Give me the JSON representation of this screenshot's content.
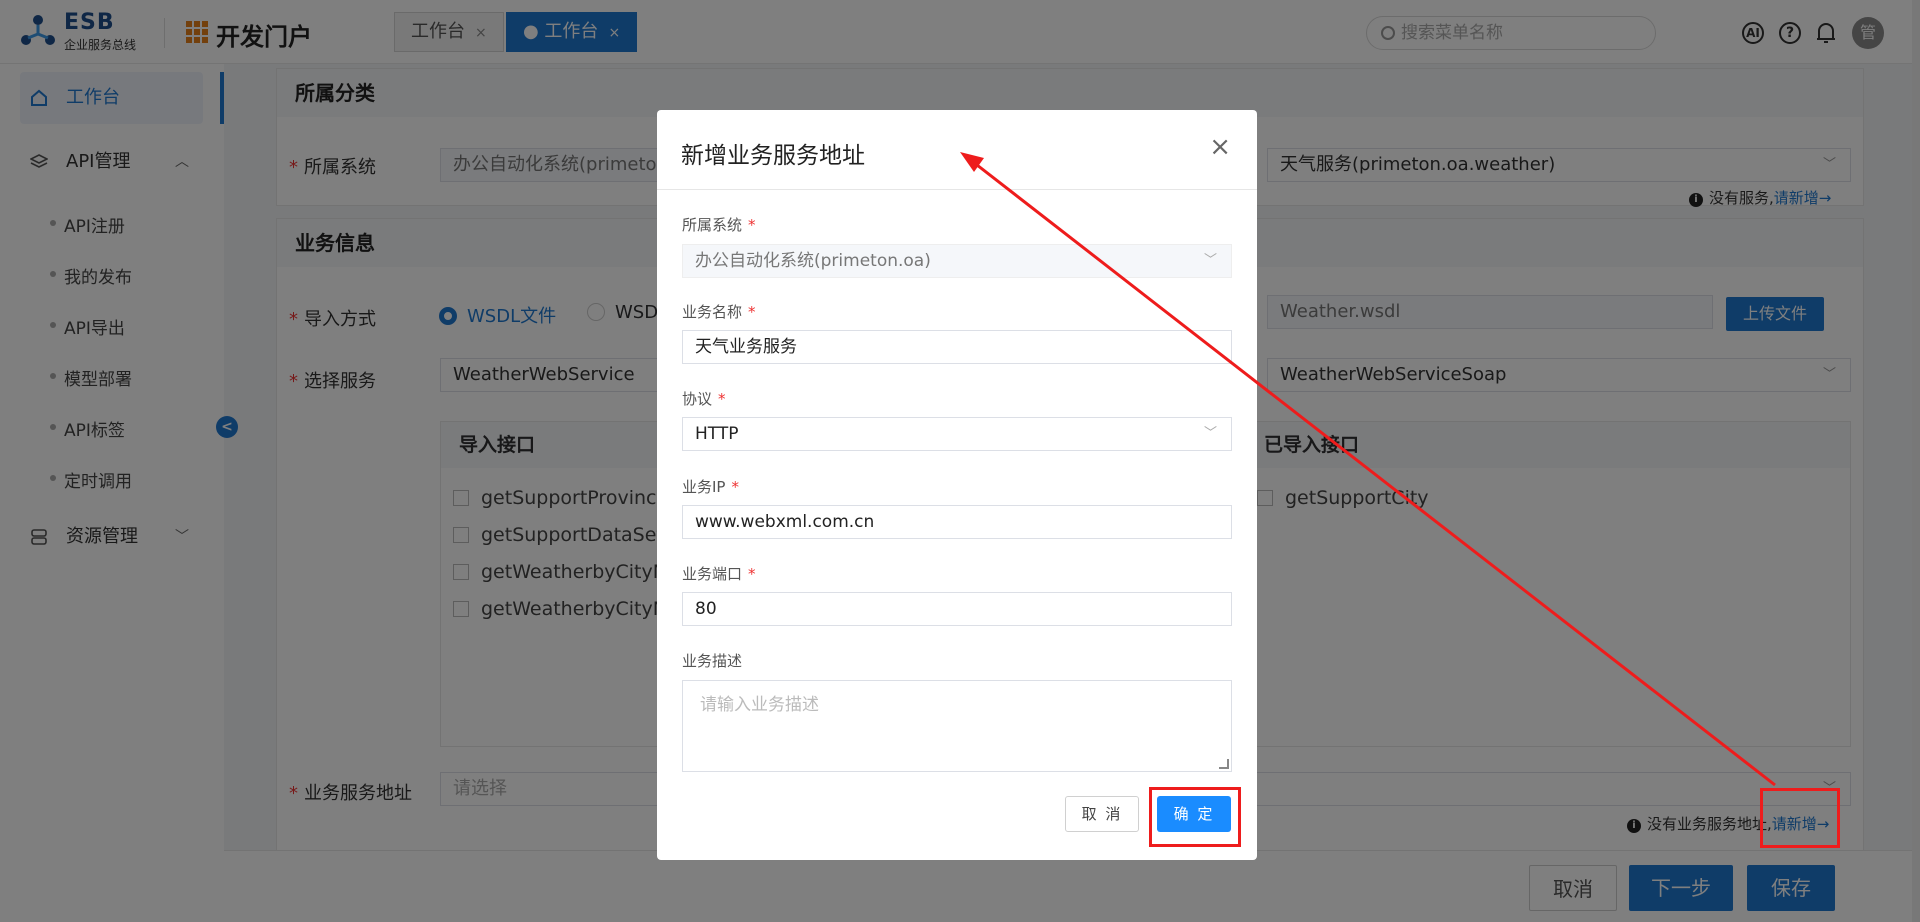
{
  "header": {
    "logo_title": "ESB",
    "logo_subtitle": "企业服务总线",
    "portal_title": "开发门户",
    "tabs": [
      {
        "label": "工作台",
        "close": "×",
        "active": false
      },
      {
        "label": "● 工作台",
        "close": "×",
        "active": true
      }
    ],
    "search_placeholder": "搜索菜单名称",
    "ai_icon_label": "AI",
    "help_icon_label": "?",
    "avatar_text": "管"
  },
  "sidebar": {
    "items": [
      {
        "label": "工作台",
        "icon": "home-icon",
        "active": true
      },
      {
        "label": "API管理",
        "icon": "layers-icon",
        "chevron": "︿"
      },
      {
        "label": "资源管理",
        "icon": "database-icon",
        "chevron": "﹀"
      }
    ],
    "sub_items": [
      "API注册",
      "我的发布",
      "API导出",
      "模型部署",
      "API标签",
      "定时调用"
    ],
    "collapse_label": "<"
  },
  "section_category": {
    "title": "所属分类",
    "system_label": "所属系统",
    "system_value": "办公自动化系统(primeton.oa)",
    "service_value": "天气服务(primeton.oa.weather)",
    "note_text": "没有服务,",
    "note_link": "请新增→"
  },
  "section_business": {
    "title": "业务信息",
    "import_label": "导入方式",
    "radio_wsdl_file": "WSDL文件",
    "radio_wsdl_url": "WSDL",
    "file_value": "Weather.wsdl",
    "upload_button": "上传文件",
    "select_service_label": "选择服务",
    "service_value": "WeatherWebService",
    "port_value": "WeatherWebServiceSoap",
    "import_box_title": "导入接口",
    "imported_box_title": "已导入接口",
    "import_items": [
      "getSupportProvince",
      "getSupportDataSet",
      "getWeatherbyCityNa",
      "getWeatherbyCityNa"
    ],
    "imported_items": [
      "getSupportCity"
    ],
    "address_label": "业务服务地址",
    "address_placeholder": "请选择",
    "address_note": "没有业务服务地址,",
    "address_note_link": "请新增→"
  },
  "footer": {
    "cancel": "取消",
    "next": "下一步",
    "save": "保存"
  },
  "dialog": {
    "title": "新增业务服务地址",
    "close": "×",
    "system_label": "所属系统",
    "system_value": "办公自动化系统(primeton.oa)",
    "name_label": "业务名称",
    "name_value": "天气业务服务",
    "protocol_label": "协议",
    "protocol_value": "HTTP",
    "ip_label": "业务IP",
    "ip_value": "www.webxml.com.cn",
    "port_label": "业务端口",
    "port_value": "80",
    "desc_label": "业务描述",
    "desc_placeholder": "请输入业务描述",
    "cancel_button": "取 消",
    "ok_button": "确 定",
    "required_mark": "*"
  },
  "colors": {
    "primary": "#1f78d1",
    "confirm": "#1a8cff",
    "annotation_red": "#ee1c1c"
  }
}
